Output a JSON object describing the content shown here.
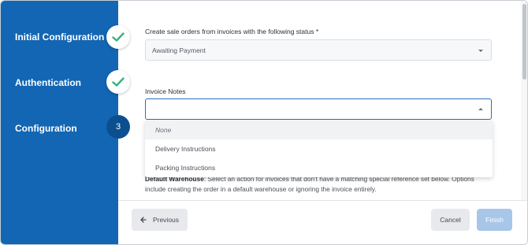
{
  "sidebar": {
    "steps": [
      {
        "label": "Initial Configuration",
        "state": "done",
        "icon": "check-icon"
      },
      {
        "label": "Authentication",
        "state": "done",
        "icon": "check-icon"
      },
      {
        "label": "Configuration",
        "state": "current",
        "number": "3"
      }
    ]
  },
  "form": {
    "status_label": "Create sale orders from invoices with the following status",
    "required_marker": "*",
    "status_value": "Awaiting Payment",
    "notes_label": "Invoice Notes",
    "notes_value": "",
    "notes_options": [
      "None",
      "Delivery Instructions",
      "Packing Instructions"
    ],
    "warehouse_label": "Default Warehouse",
    "warehouse_help": ": Select an action for invoices that don't have a matching special reference set below. Options include creating the order in a default warehouse or ignoring the invoice entirely."
  },
  "footer": {
    "previous_label": "Previous",
    "cancel_label": "Cancel",
    "finish_label": "Finish"
  },
  "colors": {
    "sidebar": "#1366b3",
    "check": "#36b37e",
    "focus_border": "#2a6fb8",
    "finish_button": "#a8c7e8"
  }
}
